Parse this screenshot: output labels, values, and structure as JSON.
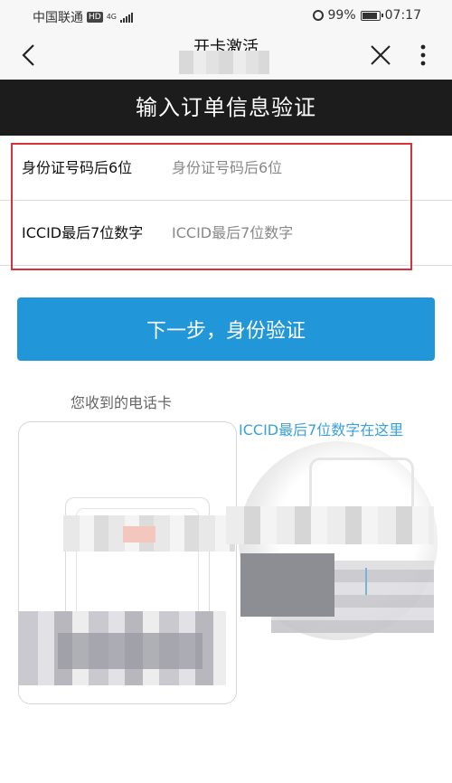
{
  "status_bar": {
    "carrier": "中国联通",
    "hd_badge": "HD",
    "network": "4G",
    "battery_percent": "99%",
    "battery_level": 0.99,
    "time": "07:17"
  },
  "nav": {
    "title": "开卡激活",
    "icons": [
      "chevron-left-icon",
      "close-icon",
      "more-vertical-icon"
    ]
  },
  "banner": {
    "title": "输入订单信息验证"
  },
  "form": {
    "fields": [
      {
        "label": "身份证号码后6位",
        "placeholder": "身份证号码后6位",
        "value": ""
      },
      {
        "label": "ICCID最后7位数字",
        "placeholder": "ICCID最后7位数字",
        "value": ""
      }
    ],
    "highlight_color": "#d9303a"
  },
  "next_button": {
    "label": "下一步，身份验证",
    "color": "#2196d8"
  },
  "illustration": {
    "caption": "您收到的电话卡",
    "iccid_hint": "ICCID最后7位数字在这里",
    "hint_color": "#3aa0dc"
  }
}
